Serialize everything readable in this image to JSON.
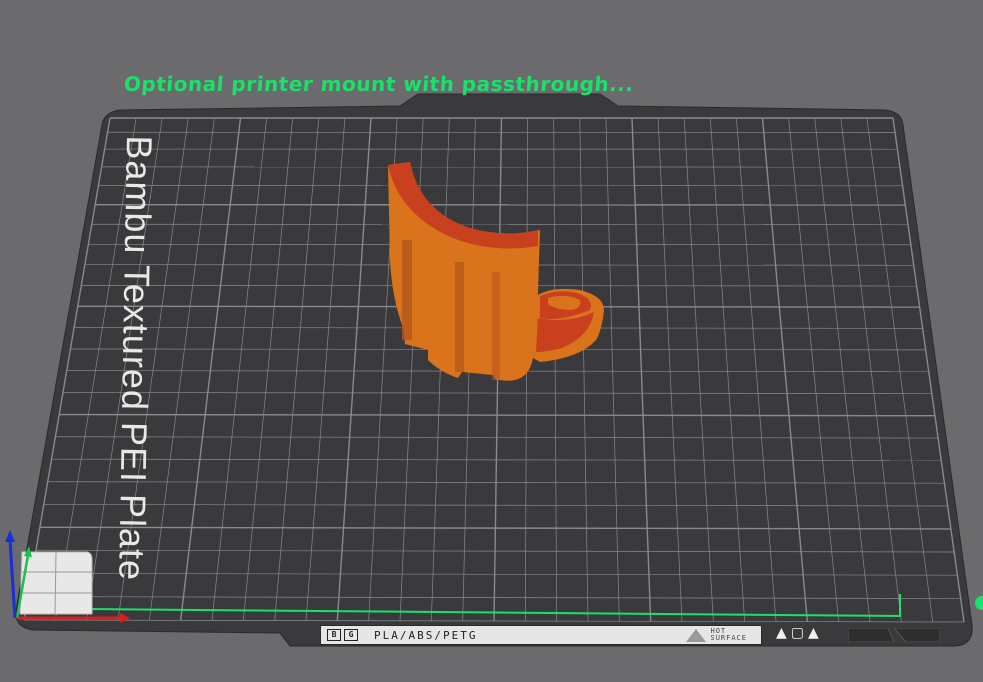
{
  "plate": {
    "title": "Optional printer mount with passthrough...",
    "brand_text": "Bambu Textured PEI Plate",
    "label_strip": {
      "logo_left": "B",
      "logo_right": "G",
      "materials": "PLA/ABS/PETG",
      "warning_line1": "HOT",
      "warning_line2": "SURFACE"
    },
    "icons": [
      "plate-icon",
      "square-icon",
      "plate-icon"
    ]
  },
  "colors": {
    "background": "#6b6b6e",
    "plate": "#3a3a3d",
    "grid": "#8a8a8e",
    "title_text": "#19e26a",
    "model_body": "#d9731c",
    "model_edge": "#c8401e",
    "axis_x": "#d62020",
    "axis_y": "#19c24a",
    "axis_z": "#1a2fd6"
  }
}
